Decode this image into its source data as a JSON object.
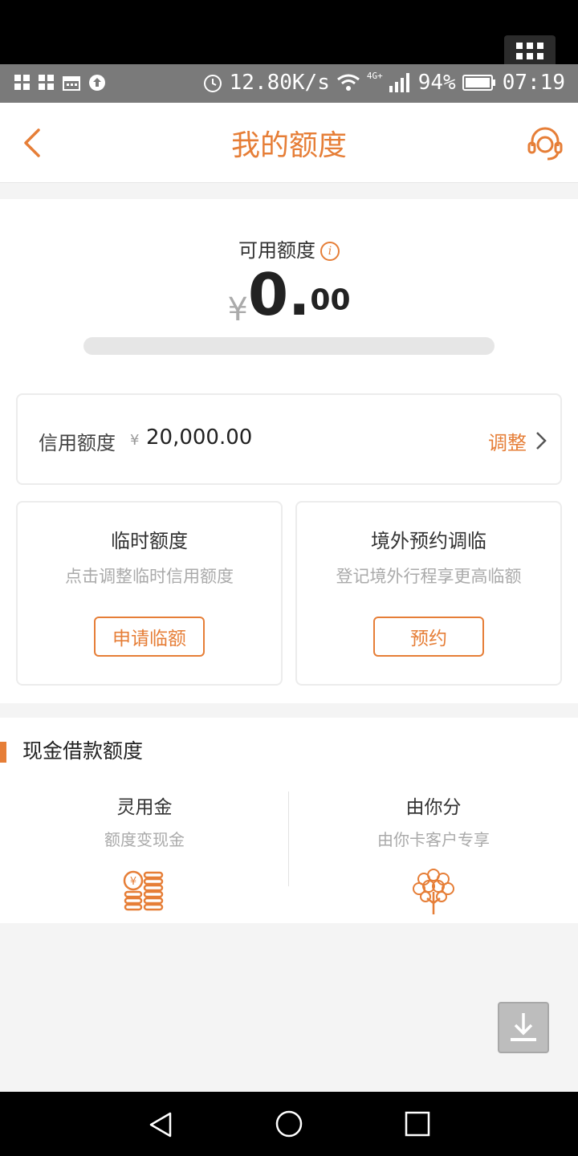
{
  "status_bar": {
    "net_speed": "12.80K/s",
    "network_type": "4G+",
    "battery": "94%",
    "time": "07:19"
  },
  "header": {
    "title": "我的额度"
  },
  "available": {
    "label": "可用额度",
    "currency": "¥",
    "integer": "0.",
    "decimal": "00",
    "used_fraction": 0
  },
  "credit": {
    "label": "信用额度",
    "currency": "¥",
    "value": "20,000.00",
    "action": "调整"
  },
  "temp_limit": {
    "title": "临时额度",
    "subtitle": "点击调整临时信用额度",
    "button": "申请临额"
  },
  "overseas": {
    "title": "境外预约调临",
    "subtitle": "登记境外行程享更高临额",
    "button": "预约"
  },
  "cash": {
    "heading": "现金借款额度",
    "items": [
      {
        "name": "灵用金",
        "desc": "额度变现金",
        "icon": "coins-icon"
      },
      {
        "name": "由你分",
        "desc": "由你卡客户专享",
        "icon": "money-tree-icon"
      }
    ]
  },
  "colors": {
    "accent": "#e67e37"
  }
}
